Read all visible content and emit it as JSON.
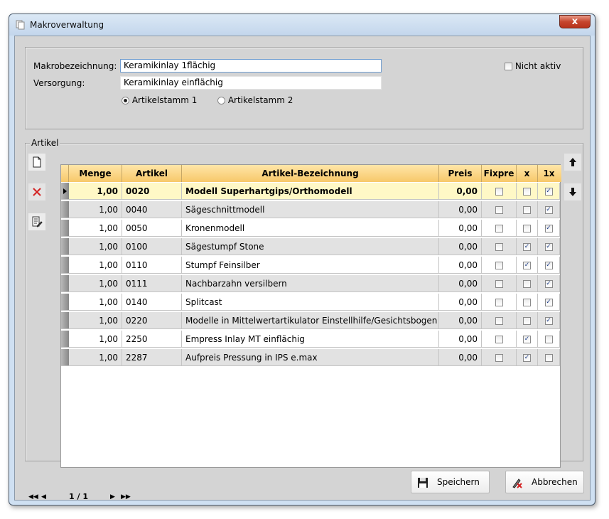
{
  "window": {
    "title": "Makroverwaltung",
    "close_glyph": "x"
  },
  "form": {
    "makro_label": "Makrobezeichnung:",
    "makro_value": "Keramikinlay 1flächig",
    "versorgung_label": "Versorgung:",
    "versorgung_value": "Keramikinlay einflächig",
    "radio_artikelstamm1": "Artikelstamm 1",
    "radio_artikelstamm2": "Artikelstamm 2",
    "nicht_aktiv_label": "Nicht aktiv"
  },
  "artikel_group": {
    "legend": "Artikel"
  },
  "grid": {
    "columns": [
      "Menge",
      "Artikel",
      "Artikel-Bezeichnung",
      "Preis",
      "Fixpre",
      "x",
      "1x"
    ],
    "rows": [
      {
        "menge": "1,00",
        "artikel": "0020",
        "bezeichnung": "Modell Superhartgips/Orthomodell",
        "preis": "0,00",
        "fixpreis": false,
        "x": false,
        "einx": true
      },
      {
        "menge": "1,00",
        "artikel": "0040",
        "bezeichnung": "Sägeschnittmodell",
        "preis": "0,00",
        "fixpreis": false,
        "x": false,
        "einx": true
      },
      {
        "menge": "1,00",
        "artikel": "0050",
        "bezeichnung": "Kronenmodell",
        "preis": "0,00",
        "fixpreis": false,
        "x": false,
        "einx": true
      },
      {
        "menge": "1,00",
        "artikel": "0100",
        "bezeichnung": "Sägestumpf Stone",
        "preis": "0,00",
        "fixpreis": false,
        "x": true,
        "einx": true
      },
      {
        "menge": "1,00",
        "artikel": "0110",
        "bezeichnung": "Stumpf Feinsilber",
        "preis": "0,00",
        "fixpreis": false,
        "x": true,
        "einx": true
      },
      {
        "menge": "1,00",
        "artikel": "0111",
        "bezeichnung": "Nachbarzahn versilbern",
        "preis": "0,00",
        "fixpreis": false,
        "x": false,
        "einx": true
      },
      {
        "menge": "1,00",
        "artikel": "0140",
        "bezeichnung": "Splitcast",
        "preis": "0,00",
        "fixpreis": false,
        "x": false,
        "einx": true
      },
      {
        "menge": "1,00",
        "artikel": "0220",
        "bezeichnung": "Modelle in Mittelwertartikulator Einstellhilfe/Gesichtsbogen",
        "preis": "0,00",
        "fixpreis": false,
        "x": false,
        "einx": true
      },
      {
        "menge": "1,00",
        "artikel": "2250",
        "bezeichnung": "Empress Inlay MT einflächig",
        "preis": "0,00",
        "fixpreis": false,
        "x": true,
        "einx": false
      },
      {
        "menge": "1,00",
        "artikel": "2287",
        "bezeichnung": "Aufpreis Pressung in IPS e.max",
        "preis": "0,00",
        "fixpreis": false,
        "x": true,
        "einx": false
      }
    ]
  },
  "navigator": {
    "page": "1 / 1"
  },
  "buttons": {
    "save": "Speichern",
    "cancel": "Abbrechen"
  },
  "icons": {
    "new": "new-document-icon",
    "delete": "delete-x-icon",
    "edit": "edit-list-icon",
    "up": "arrow-up-icon",
    "down": "arrow-down-icon"
  },
  "colors": {
    "header": "#f7c86a",
    "selected_row": "#fff8c6",
    "delete_red": "#d42020"
  }
}
